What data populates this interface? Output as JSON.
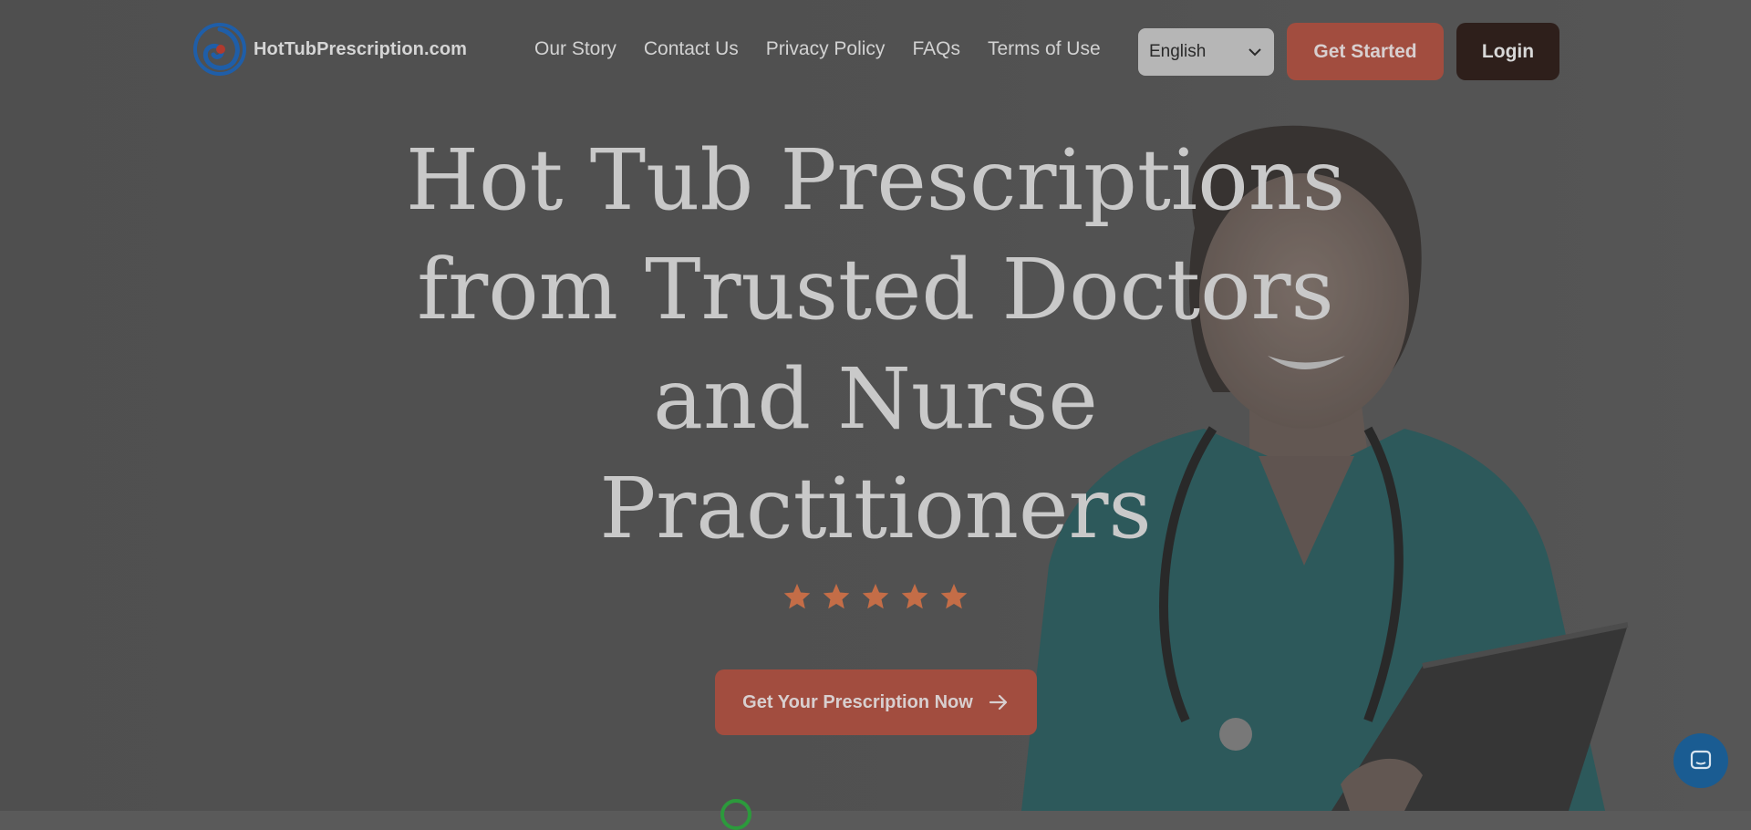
{
  "brand": {
    "name": "HotTubPrescription.com",
    "logo_icon": "swirl-logo-icon"
  },
  "nav": {
    "links": [
      "Our Story",
      "Contact Us",
      "Privacy Policy",
      "FAQs",
      "Terms of Use"
    ],
    "language": {
      "selected": "English",
      "icon": "chevron-down-icon"
    },
    "get_started_label": "Get Started",
    "login_label": "Login"
  },
  "hero": {
    "headline_lines": [
      "Hot Tub Prescriptions",
      "from Trusted Doctors",
      "and Nurse",
      "Practitioners"
    ],
    "rating": {
      "stars": 5,
      "max": 5
    },
    "cta_label": "Get Your Prescription Now",
    "cta_icon": "arrow-right-icon"
  },
  "chat_widget": {
    "icon": "chat-icon"
  },
  "colors": {
    "accent": "#a24d3f",
    "dark_button": "#2e1f1b",
    "star": "#c46d47",
    "logo_blue": "#1f5ea8",
    "chat_blue": "#1a5c92",
    "scrubs_teal": "#2f6467"
  }
}
